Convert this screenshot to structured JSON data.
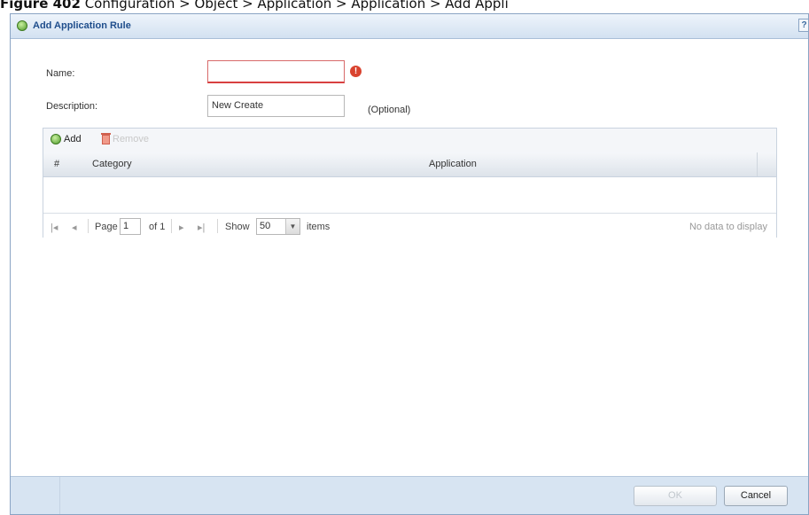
{
  "caption": {
    "prefix": "Figure 402",
    "path": "  Configuration > Object > Application > Application > Add Appli"
  },
  "dialog": {
    "title": "Add Application Rule",
    "help_label": "?"
  },
  "form": {
    "name_label": "Name:",
    "name_value": "",
    "description_label": "Description:",
    "description_value": "New Create",
    "optional_note": "(Optional)"
  },
  "toolbar": {
    "add_label": "Add",
    "remove_label": "Remove"
  },
  "table": {
    "columns": [
      "#",
      "Category",
      "Application"
    ],
    "rows": []
  },
  "pager": {
    "page_label": "Page",
    "page_value": "1",
    "of_label": "of 1",
    "show_label": "Show",
    "page_size": "50",
    "items_label": "items",
    "empty_message": "No data to display"
  },
  "buttons": {
    "ok_label": "OK",
    "cancel_label": "Cancel"
  },
  "colors": {
    "title_text": "#1f4e8c",
    "error_icon": "#d9432f",
    "footer_bg": "#d7e4f2"
  }
}
